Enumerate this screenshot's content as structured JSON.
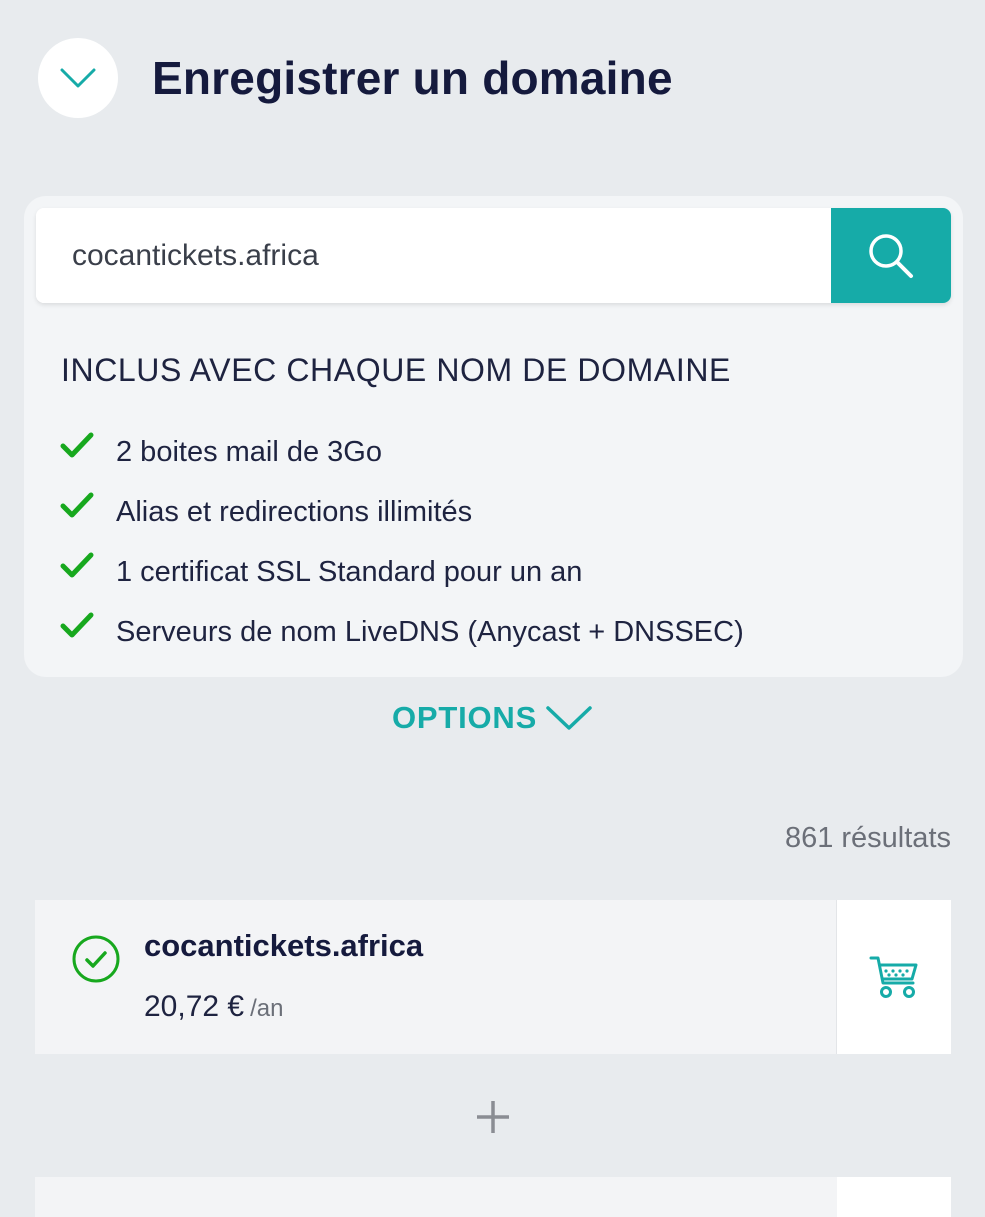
{
  "header": {
    "title": "Enregistrer un domaine",
    "collapse_icon": "chevron-down-icon"
  },
  "search": {
    "value": "cocantickets.africa",
    "button_icon": "search-icon"
  },
  "included": {
    "title": "INCLUS AVEC CHAQUE NOM DE DOMAINE",
    "features": [
      "2 boites mail de 3Go",
      "Alias et redirections illimités",
      "1 certificat SSL Standard pour un an",
      "Serveurs de nom LiveDNS (Anycast + DNSSEC)"
    ]
  },
  "options": {
    "label": "OPTIONS"
  },
  "results": {
    "count_label": "861 résultats",
    "items": [
      {
        "domain": "cocantickets.africa",
        "price": "20,72 €",
        "unit": "/an",
        "status": "available"
      }
    ]
  },
  "colors": {
    "accent": "#16aba8",
    "check": "#17a81e",
    "title": "#151a3d",
    "background": "#e8ebee"
  }
}
